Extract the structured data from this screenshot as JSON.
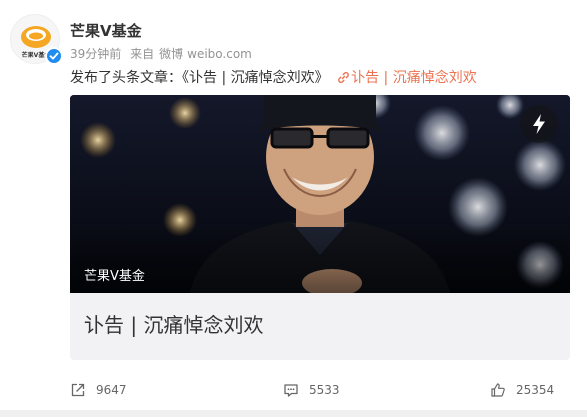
{
  "user": {
    "name": "芒果V基金",
    "avatar_text": "芒果V基金"
  },
  "meta": {
    "time": "39分钟前",
    "source_prefix": "来自",
    "source_app": "微博",
    "source_site": "weibo.com"
  },
  "post": {
    "text": "发布了头条文章：《讣告 | 沉痛悼念刘欢》",
    "link_text": "讣告 | 沉痛悼念刘欢"
  },
  "card": {
    "source": "芒果V基金",
    "title": "讣告 | 沉痛悼念刘欢"
  },
  "actions": {
    "repost_count": "9647",
    "comment_count": "5533",
    "like_count": "25354"
  },
  "colors": {
    "link_orange": "#eb7350",
    "verified_blue": "#1e8cf0",
    "card_background": "#f2f2f5"
  },
  "icons": [
    "verified-badge-icon",
    "link-icon",
    "lightning-icon",
    "repost-icon",
    "comment-icon",
    "like-icon"
  ]
}
